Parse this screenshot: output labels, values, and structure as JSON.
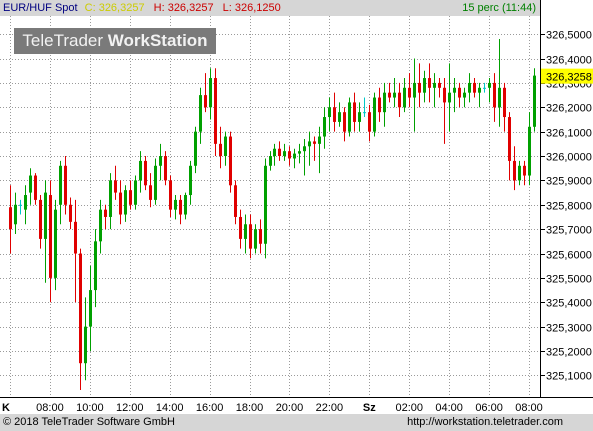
{
  "header": {
    "symbol": "EUR/HUF Spot",
    "close_label": "C: 326,3257",
    "high_label": "H: 326,3257",
    "low_label": "L: 326,1250",
    "timeframe": "15 perc (11:44)"
  },
  "watermark": {
    "part1": "TeleTrader ",
    "part2": "WorkStation"
  },
  "footer": {
    "copyright": "© 2018 TeleTrader Software GmbH",
    "url": "http://workstation.teletrader.com"
  },
  "colors": {
    "up": "#00a000",
    "down": "#e00000",
    "doji": "#00c8c8",
    "last_price_bg": "#ffff00"
  },
  "chart_data": {
    "type": "candlestick",
    "title": "EUR/HUF Spot",
    "interval": "15 perc",
    "y_ticks": [
      "326,5000",
      "326,4000",
      "326,3000",
      "326,2000",
      "326,1000",
      "326,0000",
      "325,9000",
      "325,8000",
      "325,7000",
      "325,6000",
      "325,5000",
      "325,4000",
      "325,3000",
      "325,2000",
      "325,1000"
    ],
    "ylim": [
      325.04,
      326.55
    ],
    "x_ticks": [
      {
        "label": "K",
        "pos": 0
      },
      {
        "label": "08:00",
        "pos": 8
      },
      {
        "label": "10:00",
        "pos": 16
      },
      {
        "label": "12:00",
        "pos": 24
      },
      {
        "label": "14:00",
        "pos": 32
      },
      {
        "label": "16:00",
        "pos": 40
      },
      {
        "label": "18:00",
        "pos": 48
      },
      {
        "label": "20:00",
        "pos": 56
      },
      {
        "label": "22:00",
        "pos": 64
      },
      {
        "label": "Sz",
        "pos": 72
      },
      {
        "label": "02:00",
        "pos": 80
      },
      {
        "label": "04:00",
        "pos": 88
      },
      {
        "label": "06:00",
        "pos": 96
      },
      {
        "label": "08:00",
        "pos": 104
      }
    ],
    "last_price": "326,3258",
    "last_value": 326.3258,
    "candles": [
      [
        325.79,
        325.88,
        325.6,
        325.7
      ],
      [
        325.72,
        325.85,
        325.68,
        325.8
      ],
      [
        325.8,
        325.82,
        325.76,
        325.8
      ],
      [
        325.78,
        325.88,
        325.72,
        325.84
      ],
      [
        325.85,
        325.95,
        325.8,
        325.92
      ],
      [
        325.92,
        325.93,
        325.8,
        325.82
      ],
      [
        325.82,
        325.84,
        325.62,
        325.66
      ],
      [
        325.66,
        325.9,
        325.48,
        325.85
      ],
      [
        325.84,
        325.9,
        325.4,
        325.5
      ],
      [
        325.5,
        325.82,
        325.45,
        325.78
      ],
      [
        325.8,
        325.98,
        325.72,
        325.96
      ],
      [
        325.96,
        326.0,
        325.76,
        325.8
      ],
      [
        325.8,
        325.83,
        325.7,
        325.73
      ],
      [
        325.73,
        325.82,
        325.4,
        325.6
      ],
      [
        325.6,
        325.62,
        325.04,
        325.15
      ],
      [
        325.15,
        325.42,
        325.08,
        325.3
      ],
      [
        325.3,
        325.55,
        325.2,
        325.45
      ],
      [
        325.45,
        325.7,
        325.38,
        325.65
      ],
      [
        325.65,
        325.82,
        325.6,
        325.78
      ],
      [
        325.78,
        325.8,
        325.7,
        325.75
      ],
      [
        325.75,
        325.93,
        325.7,
        325.9
      ],
      [
        325.9,
        325.96,
        325.82,
        325.85
      ],
      [
        325.85,
        325.9,
        325.72,
        325.76
      ],
      [
        325.76,
        325.88,
        325.73,
        325.86
      ],
      [
        325.86,
        325.9,
        325.78,
        325.8
      ],
      [
        325.8,
        325.92,
        325.78,
        325.9
      ],
      [
        325.9,
        326.02,
        325.85,
        325.98
      ],
      [
        325.98,
        326.0,
        325.86,
        325.88
      ],
      [
        325.88,
        325.93,
        325.79,
        325.82
      ],
      [
        325.82,
        325.99,
        325.8,
        325.96
      ],
      [
        325.96,
        326.05,
        325.9,
        326.0
      ],
      [
        326.0,
        326.02,
        325.88,
        325.9
      ],
      [
        325.9,
        325.92,
        325.75,
        325.78
      ],
      [
        325.78,
        325.84,
        325.74,
        325.82
      ],
      [
        325.82,
        325.84,
        325.72,
        325.76
      ],
      [
        325.76,
        325.85,
        325.74,
        325.84
      ],
      [
        325.84,
        325.98,
        325.8,
        325.96
      ],
      [
        325.96,
        326.12,
        325.93,
        326.1
      ],
      [
        326.1,
        326.28,
        326.05,
        326.25
      ],
      [
        326.25,
        326.34,
        326.18,
        326.2
      ],
      [
        326.2,
        326.36,
        326.15,
        326.32
      ],
      [
        326.32,
        326.36,
        326.0,
        326.05
      ],
      [
        326.05,
        326.12,
        325.95,
        326.0
      ],
      [
        326.0,
        326.1,
        325.96,
        326.08
      ],
      [
        326.08,
        326.1,
        325.85,
        325.88
      ],
      [
        325.88,
        325.9,
        325.72,
        325.75
      ],
      [
        325.75,
        325.78,
        325.62,
        325.66
      ],
      [
        325.66,
        325.76,
        325.6,
        325.72
      ],
      [
        325.72,
        325.76,
        325.58,
        325.62
      ],
      [
        325.62,
        325.72,
        325.6,
        325.7
      ],
      [
        325.7,
        325.74,
        325.6,
        325.64
      ],
      [
        325.64,
        325.99,
        325.58,
        325.96
      ],
      [
        325.96,
        326.02,
        325.94,
        326.0
      ],
      [
        326.0,
        326.05,
        325.96,
        326.03
      ],
      [
        326.03,
        326.06,
        325.98,
        326.0
      ],
      [
        326.0,
        326.05,
        325.98,
        326.02
      ],
      [
        326.02,
        326.04,
        325.96,
        325.99
      ],
      [
        325.99,
        326.03,
        325.95,
        326.01
      ],
      [
        326.01,
        326.05,
        325.97,
        326.02
      ],
      [
        326.02,
        326.07,
        325.92,
        326.04
      ],
      [
        326.04,
        326.1,
        325.96,
        326.06
      ],
      [
        326.06,
        326.08,
        325.98,
        326.05
      ],
      [
        326.05,
        326.12,
        325.93,
        326.08
      ],
      [
        326.08,
        326.2,
        326.03,
        326.16
      ],
      [
        326.16,
        326.24,
        326.1,
        326.2
      ],
      [
        326.2,
        326.26,
        326.1,
        326.14
      ],
      [
        326.14,
        326.22,
        326.12,
        326.18
      ],
      [
        326.18,
        326.2,
        326.06,
        326.1
      ],
      [
        326.1,
        326.24,
        326.08,
        326.22
      ],
      [
        326.22,
        326.26,
        326.1,
        326.14
      ],
      [
        326.14,
        326.22,
        326.1,
        326.18
      ],
      [
        326.18,
        326.24,
        326.16,
        326.18
      ],
      [
        326.18,
        326.21,
        326.06,
        326.1
      ],
      [
        326.1,
        326.26,
        326.08,
        326.24
      ],
      [
        326.24,
        326.28,
        326.14,
        326.18
      ],
      [
        326.18,
        326.3,
        326.12,
        326.26
      ],
      [
        326.26,
        326.3,
        326.22,
        326.24
      ],
      [
        326.24,
        326.32,
        326.2,
        326.26
      ],
      [
        326.26,
        326.3,
        326.16,
        326.2
      ],
      [
        326.2,
        326.32,
        326.18,
        326.28
      ],
      [
        326.28,
        326.34,
        326.2,
        326.24
      ],
      [
        326.24,
        326.4,
        326.1,
        326.3
      ],
      [
        326.3,
        326.38,
        326.2,
        326.26
      ],
      [
        326.26,
        326.35,
        326.22,
        326.32
      ],
      [
        326.32,
        326.38,
        326.22,
        326.28
      ],
      [
        326.28,
        326.34,
        326.2,
        326.3
      ],
      [
        326.3,
        326.32,
        326.24,
        326.28
      ],
      [
        326.28,
        326.32,
        326.05,
        326.22
      ],
      [
        326.22,
        326.38,
        326.1,
        326.26
      ],
      [
        326.26,
        326.32,
        326.18,
        326.28
      ],
      [
        326.28,
        326.3,
        326.2,
        326.24
      ],
      [
        326.24,
        326.28,
        326.2,
        326.26
      ],
      [
        326.26,
        326.34,
        326.22,
        326.3
      ],
      [
        326.3,
        326.32,
        326.24,
        326.26
      ],
      [
        326.26,
        326.3,
        326.2,
        326.28
      ],
      [
        326.28,
        326.3,
        326.26,
        326.28
      ],
      [
        326.28,
        326.32,
        326.22,
        326.3
      ],
      [
        326.3,
        326.34,
        326.14,
        326.2
      ],
      [
        326.2,
        326.48,
        326.12,
        326.28
      ],
      [
        326.28,
        326.3,
        326.1,
        326.16
      ],
      [
        326.16,
        326.18,
        325.9,
        325.98
      ],
      [
        325.98,
        326.04,
        325.86,
        325.9
      ],
      [
        325.9,
        325.98,
        325.88,
        325.96
      ],
      [
        325.96,
        325.98,
        325.88,
        325.92
      ],
      [
        325.92,
        326.18,
        325.88,
        326.12
      ],
      [
        326.12,
        326.36,
        326.1,
        326.33
      ]
    ]
  }
}
